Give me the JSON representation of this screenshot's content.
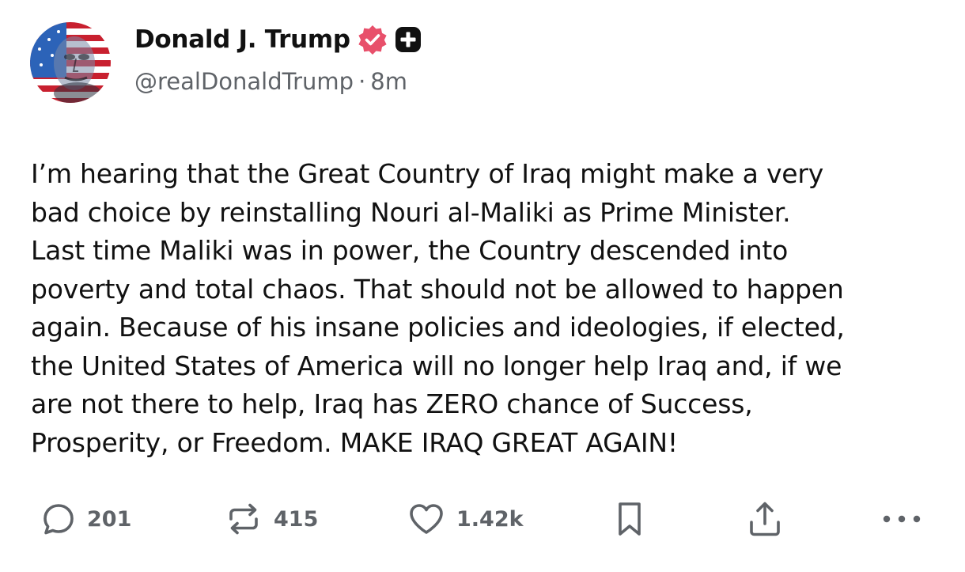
{
  "author": {
    "display_name": "Donald J. Trump",
    "handle": "@realDonaldTrump",
    "separator": "·",
    "time_ago": "8m",
    "avatar_icon": "american-flag-portrait-avatar",
    "verified_icon": "verified-badge-icon",
    "plus_icon": "plus-badge-icon"
  },
  "post": {
    "lines": [
      "I’m hearing that the Great Country of Iraq might make a very",
      "bad choice by reinstalling Nouri al-Maliki as Prime Minister.",
      "Last time Maliki was in power, the Country descended into",
      "poverty and total chaos. That should not be allowed to happen",
      "again. Because of his insane policies and ideologies, if elected,",
      "the United States of America will no longer help Iraq and, if we",
      "are not there to help, Iraq has ZERO chance of Success,",
      "Prosperity, or Freedom. MAKE IRAQ GREAT AGAIN!"
    ]
  },
  "actions": {
    "reply": {
      "icon": "reply-bubble-icon",
      "count": "201"
    },
    "retruth": {
      "icon": "retruth-icon",
      "count": "415"
    },
    "like": {
      "icon": "heart-icon",
      "count": "1.42k"
    },
    "bookmark": {
      "icon": "bookmark-icon"
    },
    "share": {
      "icon": "share-upload-icon"
    },
    "more": {
      "icon": "more-dots-icon"
    }
  },
  "colors": {
    "text": "#111111",
    "muted": "#5f6368",
    "verified_pink": "#e8506b",
    "plus_badge": "#111111",
    "icon": "#5f6368"
  }
}
